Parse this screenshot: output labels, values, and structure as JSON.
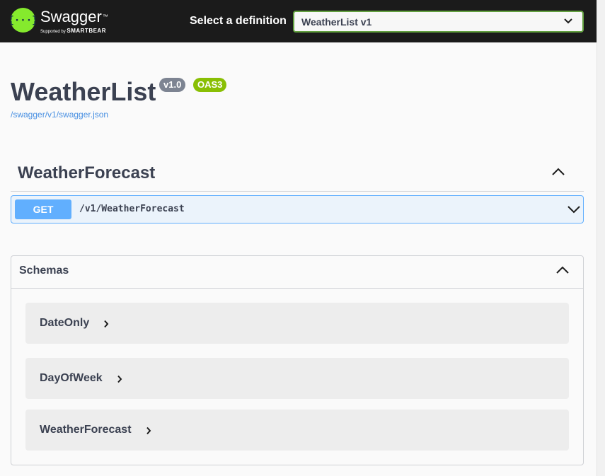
{
  "topbar": {
    "logo_word": "Swagger",
    "logo_tm": "™",
    "logo_sub_prefix": "Supported by",
    "logo_sub_brand": "SMARTBEAR",
    "select_label": "Select a definition",
    "select_value": "WeatherList v1"
  },
  "info": {
    "title": "WeatherList",
    "version_badge": "v1.0",
    "oas_badge": "OAS3",
    "spec_link": "/swagger/v1/swagger.json"
  },
  "tag": {
    "name": "WeatherForecast",
    "operations": [
      {
        "method": "GET",
        "path": "/v1/WeatherForecast"
      }
    ]
  },
  "schemas": {
    "title": "Schemas",
    "items": [
      {
        "name": "DateOnly"
      },
      {
        "name": "DayOfWeek"
      },
      {
        "name": "WeatherForecast"
      }
    ]
  },
  "colors": {
    "topbar_bg": "#1b1b1b",
    "logo_green": "#85ea2d",
    "get_blue": "#61affe",
    "oas_green": "#89bf04",
    "version_gray": "#7d8492",
    "text_dark": "#3b4151",
    "link_blue": "#4990e2"
  }
}
